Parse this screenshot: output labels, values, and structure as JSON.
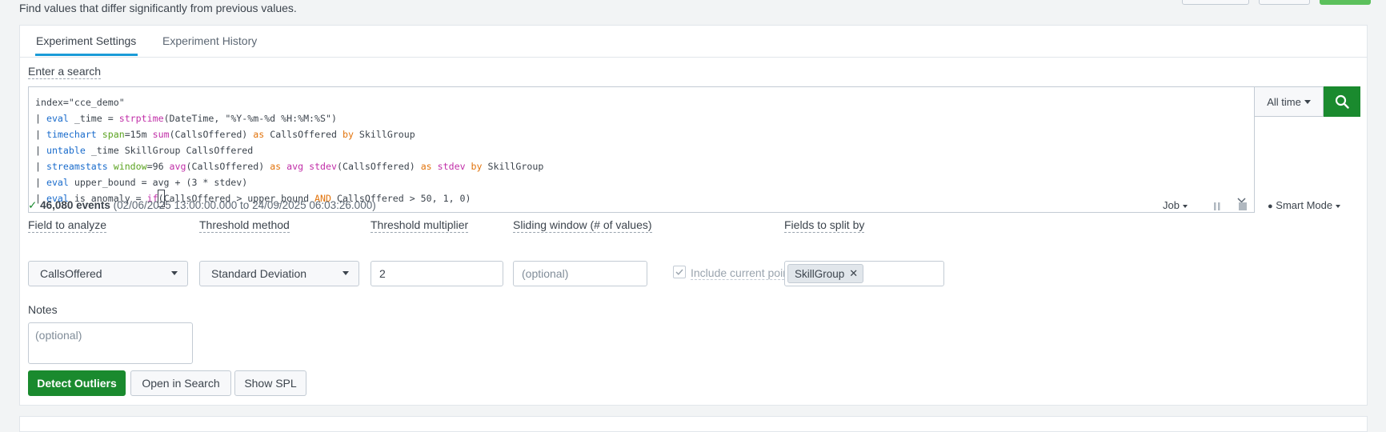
{
  "page": {
    "subtitle": "Find values that differ significantly from previous values."
  },
  "tabs": [
    {
      "label": "Experiment Settings",
      "active": true
    },
    {
      "label": "Experiment History",
      "active": false
    }
  ],
  "search": {
    "label": "Enter a search",
    "spl_lines": [
      "index=\"cce_demo\"",
      "| eval _time = strptime(DateTime, \"%Y-%m-%d %H:%M:%S\")",
      "| timechart span=15m sum(CallsOffered) as CallsOffered by SkillGroup",
      "| untable _time SkillGroup CallsOffered",
      "| streamstats window=96 avg(CallsOffered) as avg stdev(CallsOffered) as stdev by SkillGroup",
      "| eval upper_bound = avg + (3 * stdev)",
      "| eval is_anomaly = if(CallsOffered > upper_bound AND CallsOffered > 50, 1, 0)"
    ],
    "time_range": "All time",
    "search_icon": "search-icon"
  },
  "status": {
    "check": "✓",
    "events_count": "46,080 events",
    "events_range": "(02/06/2025 13:00:00.000 to 24/09/2025 06:03:26.000)",
    "job_label": "Job",
    "mode_label": "Smart Mode"
  },
  "form": {
    "field_to_analyze": {
      "label": "Field to analyze",
      "value": "CallsOffered"
    },
    "threshold_method": {
      "label": "Threshold method",
      "value": "Standard Deviation"
    },
    "threshold_multiplier": {
      "label": "Threshold multiplier",
      "value": "2"
    },
    "sliding_window": {
      "label": "Sliding window (# of values)",
      "placeholder": "(optional)"
    },
    "include_current_point": {
      "label": "Include current point",
      "checked": true
    },
    "fields_to_split": {
      "label": "Fields to split by",
      "tags": [
        "SkillGroup"
      ]
    }
  },
  "notes": {
    "label": "Notes",
    "placeholder": "(optional)"
  },
  "actions": {
    "detect": "Detect Outliers",
    "open_search": "Open in Search",
    "show_spl": "Show SPL"
  },
  "colors": {
    "primary_green": "#1a8a2e",
    "tab_accent": "#1a9bd7",
    "spl_command": "#1a6ccc",
    "spl_function": "#c12fa8",
    "spl_keyword": "#e2740d",
    "spl_argument": "#5ba320"
  }
}
